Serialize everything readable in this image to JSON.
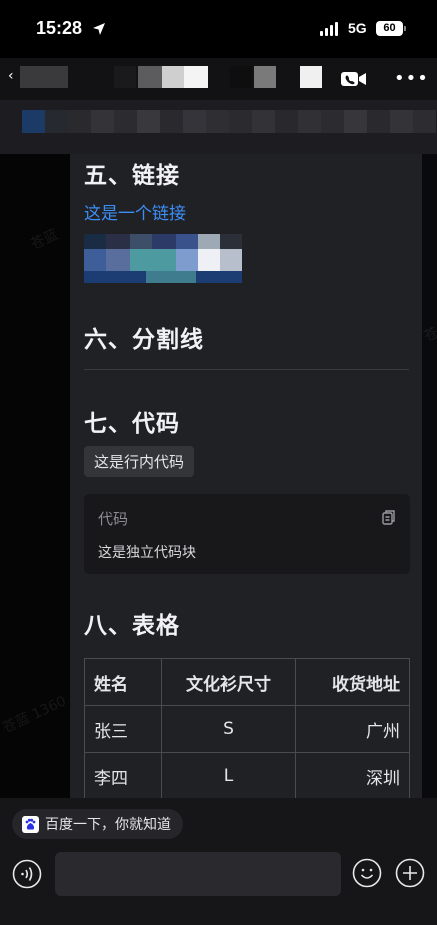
{
  "status_bar": {
    "time": "15:28",
    "network": "5G",
    "battery": "60"
  },
  "sections": {
    "link": {
      "heading": "五、链接",
      "link_text": "这是一个链接"
    },
    "divider": {
      "heading": "六、分割线"
    },
    "code": {
      "heading": "七、代码",
      "inline_code": "这是行内代码",
      "block_language": "代码",
      "block_content": "这是独立代码块"
    },
    "table": {
      "heading": "八、表格",
      "headers": [
        "姓名",
        "文化衫尺寸",
        "收货地址"
      ],
      "rows": [
        [
          "张三",
          "S",
          "广州"
        ],
        [
          "李四",
          "L",
          "深圳"
        ]
      ]
    }
  },
  "watermark": {
    "text_1": "苍蓝",
    "text_2": "苍蓝 1360",
    "text_3": "苍"
  },
  "bottom": {
    "suggestion": "百度一下，你就知道",
    "input_placeholder": ""
  },
  "icons": {
    "back": "back-icon",
    "video": "video-call-icon",
    "more": "more-icon",
    "copy": "copy-icon",
    "voice": "voice-icon",
    "emoji": "emoji-icon",
    "plus": "plus-icon",
    "baidu": "baidu-paw-icon",
    "location": "location-arrow-icon"
  },
  "colors": {
    "link": "#3e8ef7",
    "card_bg": "#202124",
    "page_bg": "#000000"
  }
}
